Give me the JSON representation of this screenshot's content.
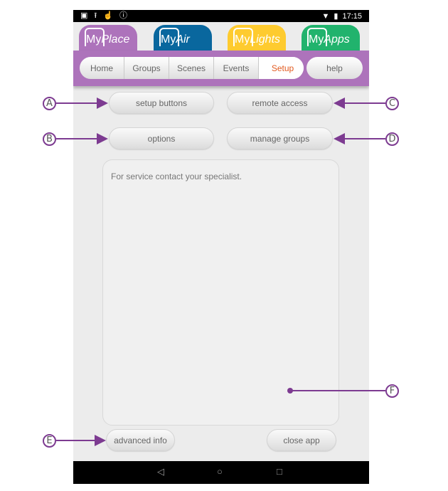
{
  "status_bar": {
    "left_icons": [
      "sd-card-icon",
      "upload-icon",
      "touch-icon",
      "info-icon"
    ],
    "right_icons": [
      "wifi-icon",
      "battery-icon"
    ],
    "time": "17:15"
  },
  "app_tabs": [
    {
      "my": "My",
      "name": "Place",
      "color": "#ad73bb",
      "active": true
    },
    {
      "my": "My",
      "name": "Air",
      "color": "#09679e",
      "active": false
    },
    {
      "my": "My",
      "name": "Lights",
      "color": "#fecb2f",
      "active": false
    },
    {
      "my": "My",
      "name": "Apps",
      "color": "#21b36d",
      "active": false
    }
  ],
  "nav": {
    "segments": [
      {
        "label": "Home",
        "active": false
      },
      {
        "label": "Groups",
        "active": false
      },
      {
        "label": "Scenes",
        "active": false
      },
      {
        "label": "Events",
        "active": false
      },
      {
        "label": "Setup",
        "active": true
      }
    ],
    "help_label": "help",
    "active_color": "#e25a1f"
  },
  "setup": {
    "setup_buttons_label": "setup buttons",
    "remote_access_label": "remote access",
    "options_label": "options",
    "manage_groups_label": "manage groups",
    "info_message": "For service contact your specialist.",
    "advanced_info_label": "advanced info",
    "close_app_label": "close app"
  },
  "android_nav": {
    "back": "◁",
    "home": "○",
    "recents": "□"
  },
  "callouts": {
    "A": "A",
    "B": "B",
    "C": "C",
    "D": "D",
    "E": "E",
    "F": "F",
    "color": "#7d3b91"
  }
}
